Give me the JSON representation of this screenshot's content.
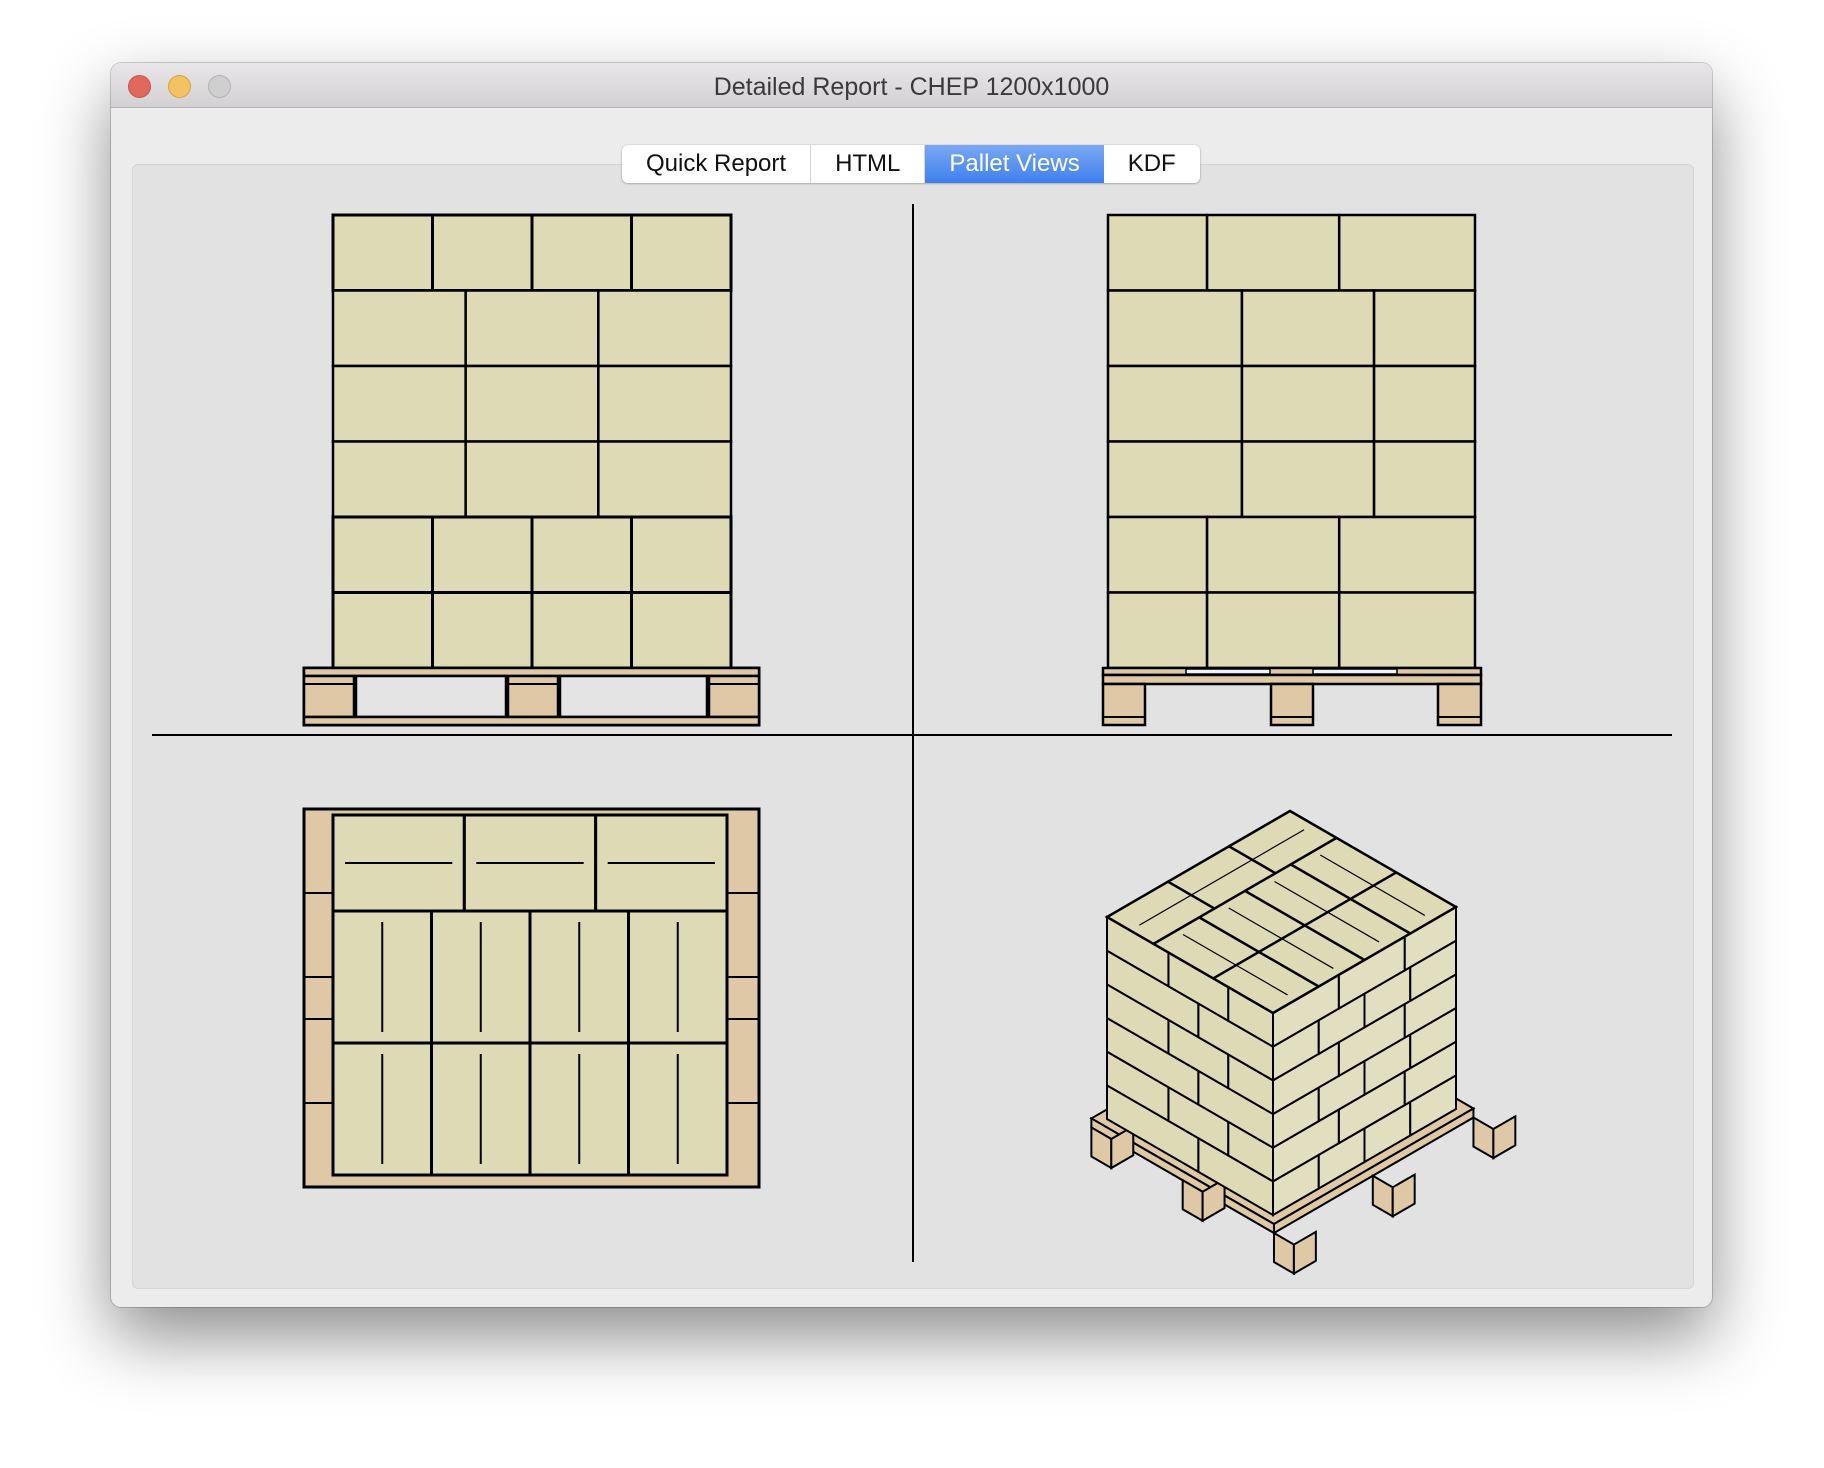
{
  "window": {
    "title": "Detailed Report - CHEP 1200x1000",
    "controls": [
      "close",
      "minimize",
      "maximize"
    ]
  },
  "tabs": [
    {
      "label": "Quick Report",
      "active": false
    },
    {
      "label": "HTML",
      "active": false
    },
    {
      "label": "Pallet Views",
      "active": true
    },
    {
      "label": "KDF",
      "active": false
    }
  ],
  "colors": {
    "box_fill": "#dedab6",
    "pallet_fill": "#dec8a6",
    "stroke": "#000000",
    "view_background": "#e2e2e2",
    "active_tab": "#4a87ef"
  },
  "pallet": {
    "name": "CHEP 1200x1000",
    "layers": 6,
    "views": [
      "front",
      "side",
      "top",
      "isometric"
    ],
    "front_view_layers": [
      {
        "pattern": "4-across",
        "boxes": 4
      },
      {
        "pattern": "3-across",
        "boxes": 3
      },
      {
        "pattern": "3-across",
        "boxes": 3
      },
      {
        "pattern": "3-across",
        "boxes": 3
      },
      {
        "pattern": "4-across",
        "boxes": 4
      },
      {
        "pattern": "4-across",
        "boxes": 4
      }
    ],
    "side_view_layers": [
      {
        "pattern": "A",
        "boxes": 3
      },
      {
        "pattern": "B",
        "boxes": 3
      },
      {
        "pattern": "B",
        "boxes": 3
      },
      {
        "pattern": "B",
        "boxes": 3
      },
      {
        "pattern": "A",
        "boxes": 3
      },
      {
        "pattern": "A",
        "boxes": 3
      }
    ],
    "top_view": {
      "rows": [
        {
          "boxes": 3,
          "orientation": "horizontal"
        },
        {
          "boxes": 4,
          "orientation": "vertical"
        },
        {
          "boxes": 4,
          "orientation": "vertical"
        }
      ],
      "boxes_per_layer": 11
    }
  }
}
